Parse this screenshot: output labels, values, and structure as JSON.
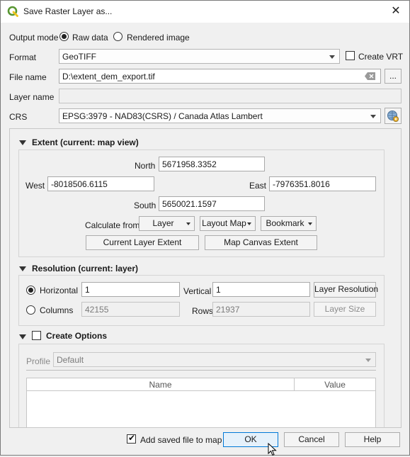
{
  "window": {
    "title": "Save Raster Layer as...",
    "icon": "qgis-icon",
    "close_glyph": "✕"
  },
  "output_mode": {
    "label": "Output mode",
    "options": [
      {
        "label": "Raw data",
        "selected": true
      },
      {
        "label": "Rendered image",
        "selected": false
      }
    ]
  },
  "format": {
    "label": "Format",
    "value": "GeoTIFF",
    "create_vrt_label": "Create VRT",
    "create_vrt_checked": false
  },
  "file_name": {
    "label": "File name",
    "value": "D:\\extent_dem_export.tif",
    "browse_label": "..."
  },
  "layer_name": {
    "label": "Layer name",
    "value": ""
  },
  "crs": {
    "label": "CRS",
    "value": "EPSG:3979 - NAD83(CSRS) / Canada Atlas Lambert"
  },
  "extent": {
    "title": "Extent (current: map view)",
    "north_label": "North",
    "north": "5671958.3352",
    "west_label": "West",
    "west": "-8018506.6115",
    "east_label": "East",
    "east": "-7976351.8016",
    "south_label": "South",
    "south": "5650021.1597",
    "calculate_from_label": "Calculate from",
    "calc_buttons": [
      "Layer",
      "Layout Map",
      "Bookmark"
    ],
    "current_layer_extent": "Current Layer Extent",
    "map_canvas_extent": "Map Canvas Extent"
  },
  "resolution": {
    "title": "Resolution (current: layer)",
    "horizontal_label": "Horizontal",
    "horizontal_selected": true,
    "horizontal": "1",
    "vertical_label": "Vertical",
    "vertical": "1",
    "layer_resolution": "Layer Resolution",
    "columns_label": "Columns",
    "columns": "42155",
    "rows_label": "Rows",
    "rows": "21937",
    "layer_size": "Layer Size"
  },
  "create_options": {
    "title": "Create Options",
    "checked": false,
    "profile_label": "Profile",
    "profile": "Default",
    "columns": [
      "Name",
      "Value"
    ]
  },
  "footer": {
    "add_saved_label": "Add saved file to map",
    "add_saved_checked": true,
    "ok": "OK",
    "cancel": "Cancel",
    "help": "Help"
  },
  "colors": {
    "accent": "#0078d7",
    "qgis_green": "#589632",
    "qgis_yellow": "#f0c419"
  }
}
